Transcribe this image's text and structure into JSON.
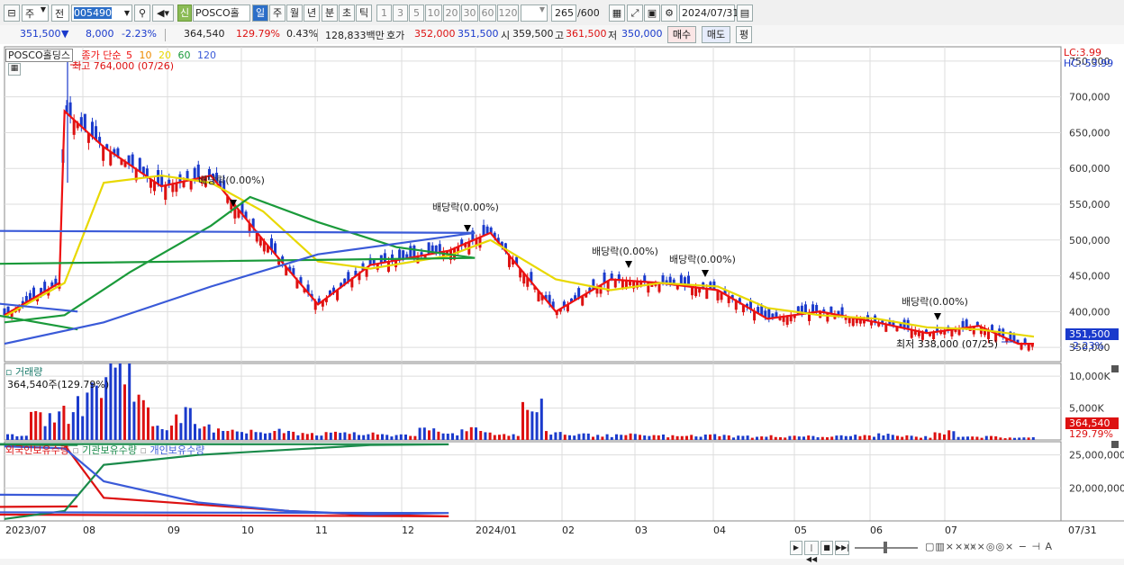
{
  "toolbar": {
    "market_label": "주",
    "prev_label": "전",
    "code": "005490",
    "new_badge": "신",
    "stock_name": "POSCO홀딩스",
    "periods": [
      "일",
      "주",
      "월",
      "년",
      "분",
      "초",
      "틱"
    ],
    "active_period": "일",
    "nums": [
      "1",
      "3",
      "5",
      "10",
      "20",
      "30",
      "60",
      "120"
    ],
    "count": "265",
    "count_total": "/600",
    "date": "2024/07/31"
  },
  "quote": {
    "price": "351,500",
    "down_arrow": "▼",
    "change": "8,000",
    "change_pct": "-2.23%",
    "volume": "364,540",
    "vol_ratio": "129.79%",
    "turnover_rate": "0.43%",
    "amount": "128,833백만",
    "ask_label": "호가",
    "ask": "352,000",
    "bid": "351,500",
    "open_label": "시",
    "open": "359,500",
    "high_label": "고",
    "high": "361,500",
    "low_label": "저",
    "low": "350,000",
    "buy_label": "매수",
    "sell_label": "매도",
    "eval_label": "평"
  },
  "main": {
    "legend_name": "POSCO홀딩스",
    "legend_type": "종가 단순",
    "ma": [
      {
        "label": "5",
        "color": "#ee1111"
      },
      {
        "label": "10",
        "color": "#ee8a00"
      },
      {
        "label": "20",
        "color": "#e8d800"
      },
      {
        "label": "60",
        "color": "#1a9a3a"
      },
      {
        "label": "120",
        "color": "#3a5ad8"
      }
    ],
    "high_note": "최고 764,000 (07/26)",
    "low_note": "최저 338,000 (07/25)",
    "lc": "LC:3.99",
    "hc": "HC:-53.99",
    "last_price": "351,500",
    "last_pct": "-2.23%",
    "dividend_labels": [
      "배당락(0.00%)",
      "배당락(0.00%)",
      "배당락(0.00%)",
      "배당락(0.00%)",
      "배당락(0.00%)"
    ]
  },
  "volume_panel": {
    "title": "거래량",
    "info": "364,540주(129.79%)",
    "last_volume": "364,540",
    "last_pct": "129.79%"
  },
  "holdings_panel": {
    "foreign_label": "외국인보유수량",
    "inst_label": "기관보유수량",
    "indiv_label": "개인보유수량"
  },
  "x_axis": [
    "2023/07",
    "08",
    "09",
    "10",
    "11",
    "12",
    "2024/01",
    "02",
    "03",
    "04",
    "05",
    "06",
    "07",
    "07/31"
  ],
  "chart_data": [
    {
      "type": "line",
      "title": "",
      "y_axis": [
        "750,000",
        "700,000",
        "650,000",
        "600,000",
        "550,000",
        "500,000",
        "450,000",
        "400,000",
        "350,000"
      ],
      "ylim": [
        330000,
        770000
      ],
      "series": [
        {
          "name": "5",
          "color": "#ee1111",
          "x": [
            "2023/07/03",
            "07/24",
            "07/26",
            "08/10",
            "09/01",
            "09/20",
            "10/10",
            "10/31",
            "11/20",
            "12/20",
            "2024/01/05",
            "01/30",
            "02/20",
            "03/10",
            "04/01",
            "04/20",
            "05/10",
            "06/01",
            "06/20",
            "07/10",
            "07/25",
            "07/31"
          ],
          "values": [
            395000,
            440000,
            680000,
            630000,
            575000,
            590000,
            500000,
            410000,
            465000,
            485000,
            510000,
            400000,
            445000,
            440000,
            430000,
            390000,
            400000,
            385000,
            370000,
            380000,
            355000,
            355000
          ]
        },
        {
          "name": "20",
          "color": "#e8d800",
          "x": [
            "2023/07/03",
            "07/26",
            "08/10",
            "09/01",
            "09/20",
            "10/10",
            "10/31",
            "11/20",
            "12/20",
            "2024/01/05",
            "01/30",
            "02/20",
            "03/10",
            "04/01",
            "04/20",
            "05/10",
            "06/01",
            "06/20",
            "07/10",
            "07/31"
          ],
          "values": [
            393000,
            440000,
            580000,
            590000,
            580000,
            540000,
            470000,
            460000,
            478000,
            500000,
            445000,
            430000,
            440000,
            435000,
            405000,
            395000,
            390000,
            378000,
            375000,
            365000
          ]
        },
        {
          "name": "60",
          "color": "#1a9a3a",
          "x": [
            "2023/07/03",
            "07/26",
            "08/20",
            "09/20",
            "10/05",
            "10/31",
            "11/30",
            "12/30",
            "01/30",
            "02/28",
            "03/30",
            "04/30",
            "05/30",
            "06/30",
            "07/31"
          ],
          "values": [
            385000,
            395000,
            455000,
            520000,
            560000,
            525000,
            490000,
            475000,
            460000,
            450000,
            445000,
            425000,
            410000,
            395000,
            375000
          ]
        },
        {
          "name": "120",
          "color": "#3a5ad8",
          "x": [
            "2023/07/03",
            "08/10",
            "09/20",
            "10/31",
            "11/30",
            "12/30",
            "01/20",
            "02/20",
            "03/20",
            "04/20",
            "05/20",
            "06/20",
            "07/31"
          ],
          "values": [
            355000,
            385000,
            435000,
            480000,
            495000,
            510000,
            515000,
            490000,
            460000,
            445000,
            430000,
            415000,
            400000
          ]
        }
      ]
    },
    {
      "type": "bar",
      "title": "",
      "y_axis": [
        "10,000K",
        "5,000K"
      ],
      "ylim": [
        0,
        12000000
      ],
      "series": [
        {
          "name": "거래량",
          "values": [
            900000,
            3500000,
            4200000,
            6000000,
            9000000,
            13500000,
            6000000,
            2500000,
            4000000,
            2000000,
            1800000,
            1500000,
            1200000,
            1500000,
            1100000,
            1000000,
            1200000,
            900000,
            800000,
            900000,
            1500000,
            1000000,
            2000000,
            1200000,
            900000,
            5000000,
            1200000,
            900000,
            800000,
            700000,
            800000,
            700000,
            600000,
            700000,
            800000,
            600000,
            500000,
            600000,
            700000,
            500000,
            600000,
            700000,
            800000,
            600000,
            500000,
            1200000,
            700000,
            500000,
            400000,
            364540
          ]
        }
      ]
    },
    {
      "type": "line",
      "title": "",
      "y_axis": [
        "25,000,000",
        "20,000,000"
      ],
      "ylim": [
        15000000,
        27000000
      ],
      "series": [
        {
          "name": "외국인보유수량",
          "color": "#dd1111",
          "x": [
            "2023/07/03",
            "07/26",
            "08/10",
            "09/15",
            "10/20",
            "11/20",
            "12/20",
            "01/20",
            "02/20",
            "03/20",
            "04/20",
            "05/20",
            "06/20",
            "07/31"
          ],
          "values": [
            26500000,
            26500000,
            18500000,
            17500000,
            16500000,
            15900000,
            15700000,
            16200000,
            16600000,
            16800000,
            16900000,
            17000000,
            17100000,
            17200000
          ]
        },
        {
          "name": "기관보유수량",
          "color": "#1a8a4a",
          "x": [
            "2023/07/03",
            "07/26",
            "08/10",
            "09/15",
            "10/20",
            "11/20",
            "12/20",
            "01/20",
            "02/20",
            "03/20",
            "04/20",
            "05/20",
            "06/20",
            "07/31"
          ],
          "values": [
            15300000,
            16500000,
            23500000,
            25000000,
            25800000,
            26500000,
            26600000,
            26700000,
            26500000,
            26600000,
            26700000,
            26600000,
            26600000,
            26500000
          ]
        },
        {
          "name": "개인보유수량",
          "color": "#3a5ad8",
          "x": [
            "2023/07/03",
            "07/26",
            "08/10",
            "09/15",
            "10/20",
            "11/20",
            "12/20",
            "01/20",
            "02/20",
            "03/20",
            "04/20",
            "05/20",
            "06/20",
            "07/31"
          ],
          "values": [
            26300000,
            26000000,
            21000000,
            17800000,
            16500000,
            16000000,
            16200000,
            16400000,
            16800000,
            17500000,
            18000000,
            18500000,
            19000000,
            18900000
          ]
        }
      ]
    }
  ]
}
